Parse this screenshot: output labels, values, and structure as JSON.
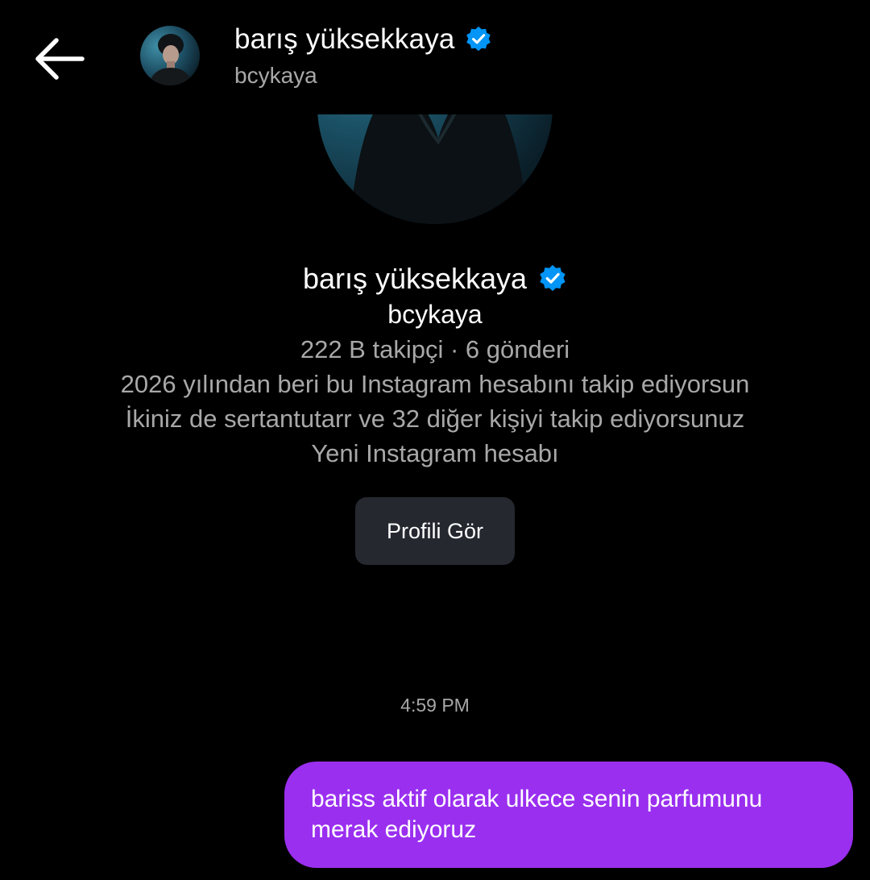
{
  "header": {
    "back_icon": "arrow-left-icon",
    "name": "barış yüksekkaya",
    "verified_icon": "verified-badge-icon",
    "username": "bcykaya"
  },
  "profile": {
    "name": "barış yüksekkaya",
    "username": "bcykaya",
    "stats": "222 B takipçi · 6 gönderi",
    "follow_since": "2026 yılından beri bu Instagram hesabını takip ediyorsun",
    "mutuals": "İkiniz de sertantutarr ve 32 diğer kişiyi takip ediyorsunuz",
    "account_note": "Yeni Instagram hesabı",
    "view_profile_label": "Profili Gör"
  },
  "messages": {
    "timestamp": "4:59 PM",
    "items": [
      {
        "from": "me",
        "text": "bariss aktif olarak ulkece senin parfumunu merak ediyoruz"
      }
    ]
  },
  "colors": {
    "background": "#000000",
    "primary_text": "#ffffff",
    "secondary_text": "#a8a8a8",
    "verified_blue": "#0095f6",
    "button_bg": "#262830",
    "outgoing_bubble": "#9a2ff0"
  }
}
